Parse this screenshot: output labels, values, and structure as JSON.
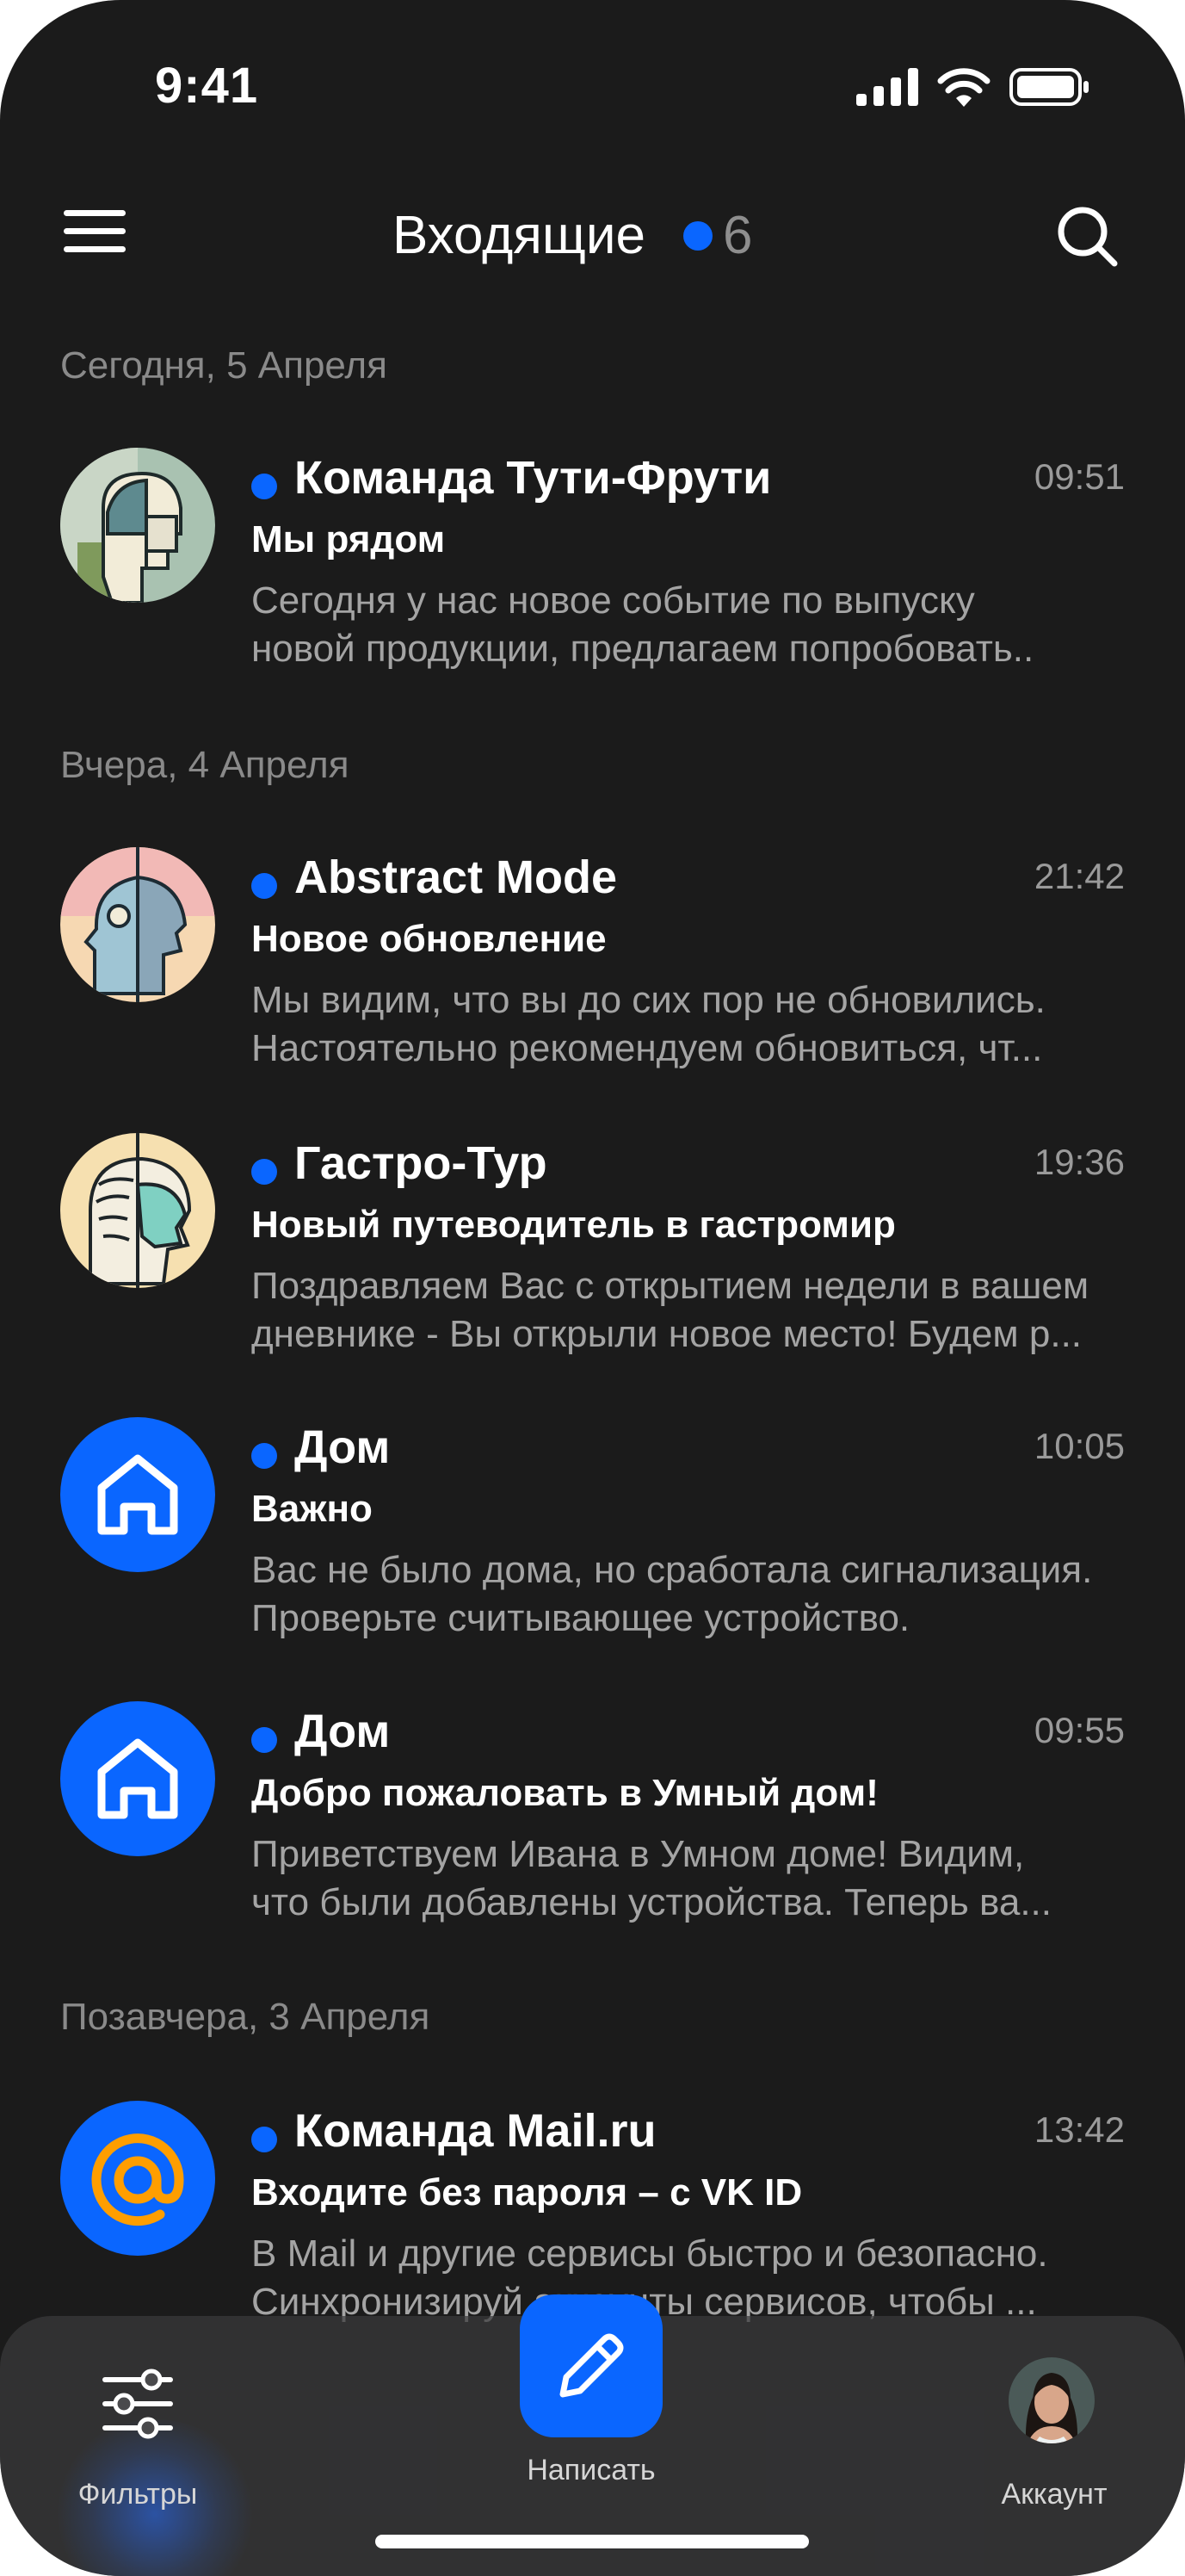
{
  "status_bar": {
    "time": "9:41"
  },
  "header": {
    "title": "Входящие",
    "unread_count": "6"
  },
  "groups": [
    {
      "date": "Сегодня, 5 Апреля"
    },
    {
      "date": "Вчера, 4 Апреля"
    },
    {
      "date": "Позавчера, 3 Апреля"
    }
  ],
  "mails": [
    {
      "sender": "Команда Тути-Фрути",
      "time": "09:51",
      "subject": "Мы рядом",
      "preview1": "Сегодня у нас новое событие по выпуску",
      "preview2": "новой продукции, предлагаем попробовать..",
      "avatar": "abstract-face-icon"
    },
    {
      "sender": "Abstract Mode",
      "time": "21:42",
      "subject": "Новое обновление",
      "preview1": "Мы видим, что вы до сих пор не обновились.",
      "preview2": "Настоятельно рекомендуем обновиться, чт...",
      "avatar": "abstract-face-icon"
    },
    {
      "sender": "Гастро-Тур",
      "time": "19:36",
      "subject": "Новый путеводитель в гастромир",
      "preview1": "Поздравляем Вас с открытием недели в вашем",
      "preview2": "дневнике - Вы открыли новое место! Будем р...",
      "avatar": "abstract-face-icon"
    },
    {
      "sender": "Дом",
      "time": "10:05",
      "subject": "Важно",
      "preview1": "Вас не было дома, но сработала сигнализация.",
      "preview2": "Проверьте считывающее устройство.",
      "avatar": "home-icon"
    },
    {
      "sender": "Дом",
      "time": "09:55",
      "subject": "Добро пожаловать в Умный дом!",
      "preview1": "Приветствуем Ивана в Умном доме! Видим,",
      "preview2": "что были добавлены устройства. Теперь ва...",
      "avatar": "home-icon"
    },
    {
      "sender": "Команда Mail.ru",
      "time": "13:42",
      "subject": "Входите без пароля – с VK ID",
      "preview1": "В Mail и другие сервисы быстро и безопасно.",
      "preview2": "Синхронизируй аккаунты сервисов, чтобы ...",
      "avatar": "at-sign-icon"
    }
  ],
  "tabbar": {
    "filters": "Фильтры",
    "compose": "Написать",
    "account": "Аккаунт"
  },
  "colors": {
    "accent": "#0a66ff",
    "background": "#1b1b1b",
    "orange": "#ff9e00"
  }
}
